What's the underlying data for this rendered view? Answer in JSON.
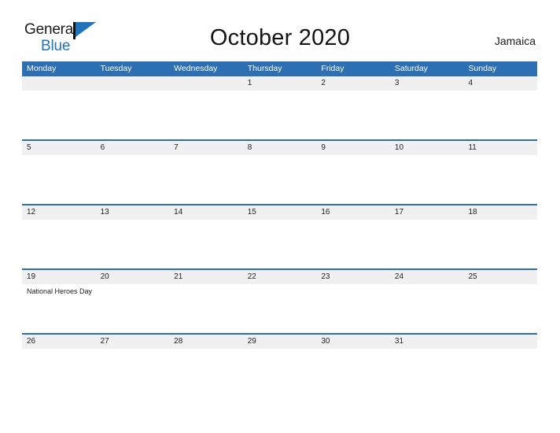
{
  "brand": {
    "word1": "General",
    "word2": "Blue",
    "flag_icon": "flag-triangle-icon"
  },
  "header": {
    "title": "October 2020",
    "country": "Jamaica"
  },
  "colors": {
    "header_blue": "#2d6fb3",
    "row_band_gray": "#f0f0f0",
    "brand_blue": "#2272bb",
    "text": "#1f1f1f",
    "page_background": "#ffffff"
  },
  "calendar": {
    "weekdays": [
      "Monday",
      "Tuesday",
      "Wednesday",
      "Thursday",
      "Friday",
      "Saturday",
      "Sunday"
    ],
    "weeks": [
      {
        "days": [
          {
            "number": "",
            "event": ""
          },
          {
            "number": "",
            "event": ""
          },
          {
            "number": "",
            "event": ""
          },
          {
            "number": "1",
            "event": ""
          },
          {
            "number": "2",
            "event": ""
          },
          {
            "number": "3",
            "event": ""
          },
          {
            "number": "4",
            "event": ""
          }
        ]
      },
      {
        "days": [
          {
            "number": "5",
            "event": ""
          },
          {
            "number": "6",
            "event": ""
          },
          {
            "number": "7",
            "event": ""
          },
          {
            "number": "8",
            "event": ""
          },
          {
            "number": "9",
            "event": ""
          },
          {
            "number": "10",
            "event": ""
          },
          {
            "number": "11",
            "event": ""
          }
        ]
      },
      {
        "days": [
          {
            "number": "12",
            "event": ""
          },
          {
            "number": "13",
            "event": ""
          },
          {
            "number": "14",
            "event": ""
          },
          {
            "number": "15",
            "event": ""
          },
          {
            "number": "16",
            "event": ""
          },
          {
            "number": "17",
            "event": ""
          },
          {
            "number": "18",
            "event": ""
          }
        ]
      },
      {
        "days": [
          {
            "number": "19",
            "event": "National Heroes Day"
          },
          {
            "number": "20",
            "event": ""
          },
          {
            "number": "21",
            "event": ""
          },
          {
            "number": "22",
            "event": ""
          },
          {
            "number": "23",
            "event": ""
          },
          {
            "number": "24",
            "event": ""
          },
          {
            "number": "25",
            "event": ""
          }
        ]
      },
      {
        "days": [
          {
            "number": "26",
            "event": ""
          },
          {
            "number": "27",
            "event": ""
          },
          {
            "number": "28",
            "event": ""
          },
          {
            "number": "29",
            "event": ""
          },
          {
            "number": "30",
            "event": ""
          },
          {
            "number": "31",
            "event": ""
          },
          {
            "number": "",
            "event": ""
          }
        ]
      }
    ]
  }
}
